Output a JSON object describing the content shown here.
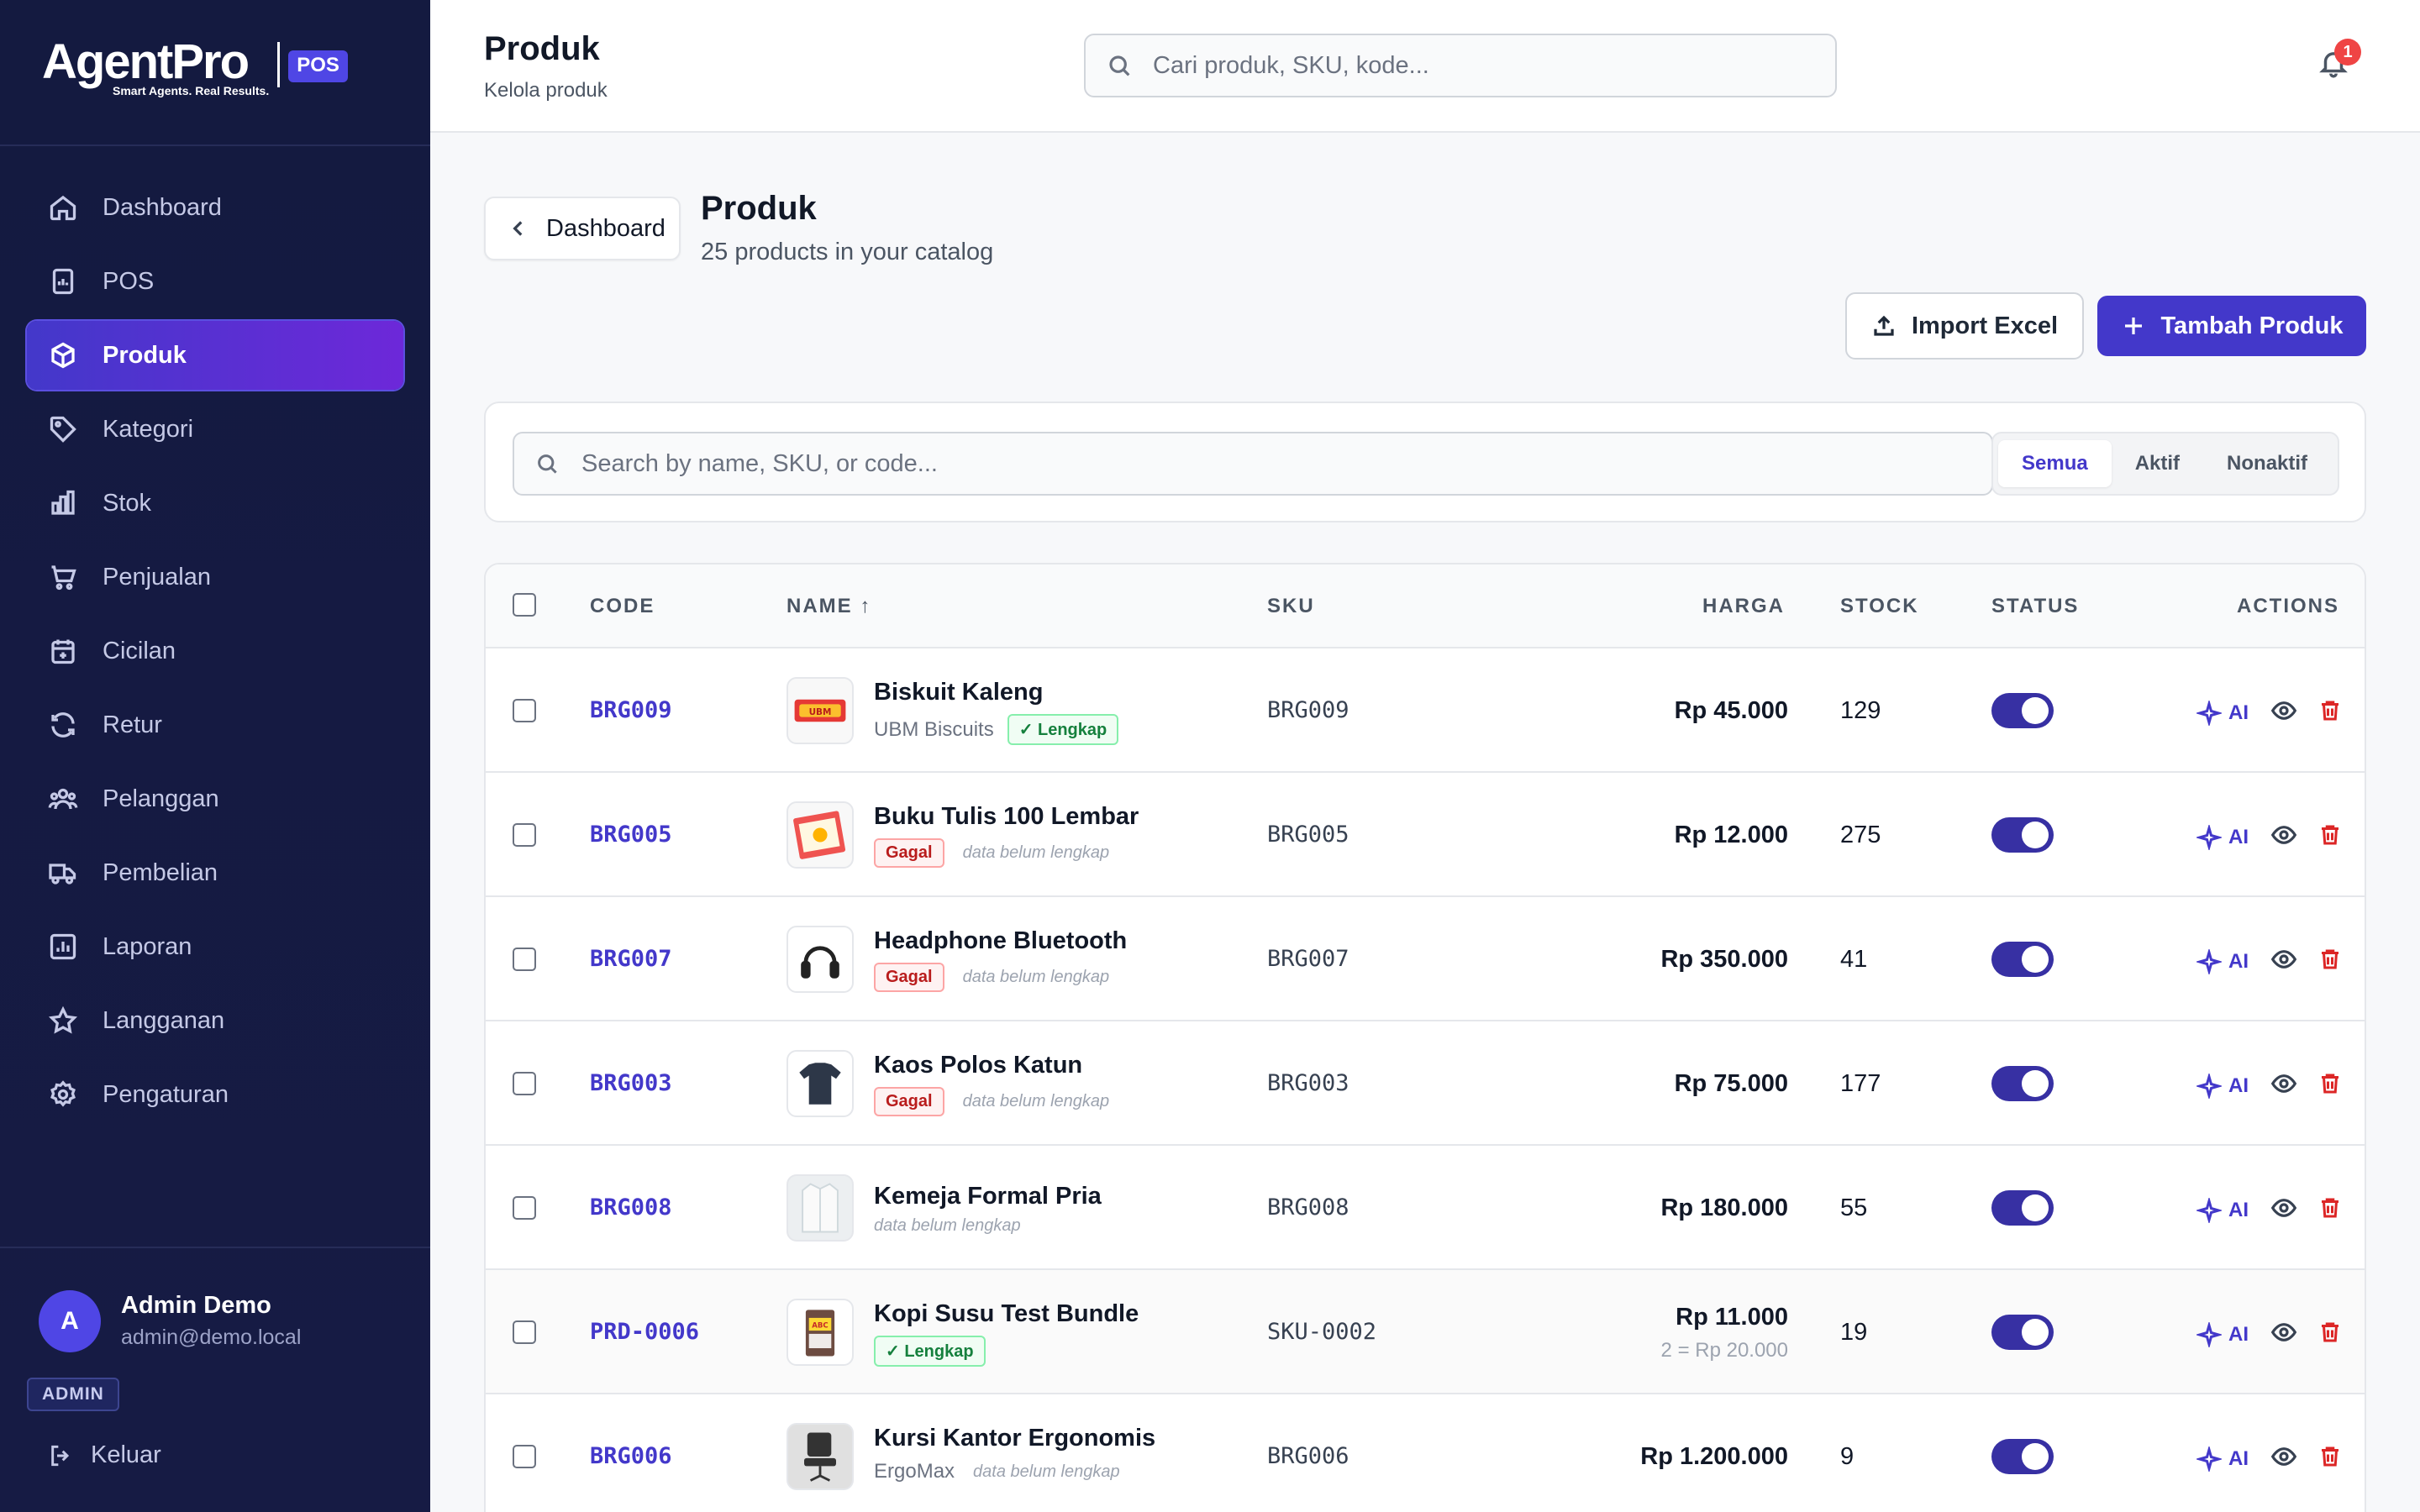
{
  "brand": {
    "name": "AgentPro",
    "tagline": "Smart Agents. Real Results.",
    "badge": "POS"
  },
  "sidebar": {
    "items": [
      {
        "label": "Dashboard",
        "icon": "home-icon"
      },
      {
        "label": "POS",
        "icon": "receipt-icon"
      },
      {
        "label": "Produk",
        "icon": "box-icon",
        "active": true
      },
      {
        "label": "Kategori",
        "icon": "tag-icon"
      },
      {
        "label": "Stok",
        "icon": "bar-chart-icon"
      },
      {
        "label": "Penjualan",
        "icon": "cart-icon"
      },
      {
        "label": "Cicilan",
        "icon": "calendar-icon"
      },
      {
        "label": "Retur",
        "icon": "refresh-icon"
      },
      {
        "label": "Pelanggan",
        "icon": "users-icon"
      },
      {
        "label": "Pembelian",
        "icon": "truck-icon"
      },
      {
        "label": "Laporan",
        "icon": "report-icon"
      },
      {
        "label": "Langganan",
        "icon": "star-icon"
      },
      {
        "label": "Pengaturan",
        "icon": "gear-icon"
      }
    ]
  },
  "user": {
    "initial": "A",
    "name": "Admin Demo",
    "email": "admin@demo.local",
    "role": "ADMIN",
    "logout": "Keluar"
  },
  "header": {
    "title": "Produk",
    "subtitle": "Kelola produk",
    "search_placeholder": "Cari produk, SKU, kode...",
    "notif_count": "1"
  },
  "page": {
    "back_label": "Dashboard",
    "title": "Produk",
    "subtitle": "25 products in your catalog",
    "import_label": "Import Excel",
    "add_label": "Tambah Produk"
  },
  "filter": {
    "search_placeholder": "Search by name, SKU, or code...",
    "tabs": [
      "Semua",
      "Aktif",
      "Nonaktif"
    ],
    "active_tab": "Semua"
  },
  "table": {
    "columns": {
      "code": "CODE",
      "name": "NAME ↑",
      "sku": "SKU",
      "price": "HARGA",
      "stock": "STOCK",
      "status": "STATUS",
      "actions": "ACTIONS"
    },
    "ai_label": "AI",
    "rows": [
      {
        "code": "BRG009",
        "name": "Biskuit Kaleng",
        "brand": "UBM Biscuits",
        "badge": "✓ Lengkap",
        "badge_type": "ok",
        "note": "",
        "sku": "BRG009",
        "price": "Rp 45.000",
        "price_sub": "",
        "stock": "129",
        "active": true
      },
      {
        "code": "BRG005",
        "name": "Buku Tulis 100 Lembar",
        "brand": "",
        "badge": "Gagal",
        "badge_type": "fail",
        "note": "data belum lengkap",
        "sku": "BRG005",
        "price": "Rp 12.000",
        "price_sub": "",
        "stock": "275",
        "active": true
      },
      {
        "code": "BRG007",
        "name": "Headphone Bluetooth",
        "brand": "",
        "badge": "Gagal",
        "badge_type": "fail",
        "note": "data belum lengkap",
        "sku": "BRG007",
        "price": "Rp 350.000",
        "price_sub": "",
        "stock": "41",
        "active": true
      },
      {
        "code": "BRG003",
        "name": "Kaos Polos Katun",
        "brand": "",
        "badge": "Gagal",
        "badge_type": "fail",
        "note": "data belum lengkap",
        "sku": "BRG003",
        "price": "Rp 75.000",
        "price_sub": "",
        "stock": "177",
        "active": true
      },
      {
        "code": "BRG008",
        "name": "Kemeja Formal Pria",
        "brand": "",
        "badge": "",
        "badge_type": "",
        "note": "data belum lengkap",
        "sku": "BRG008",
        "price": "Rp 180.000",
        "price_sub": "",
        "stock": "55",
        "active": true
      },
      {
        "code": "PRD-0006",
        "name": "Kopi Susu Test Bundle",
        "brand": "",
        "badge": "✓ Lengkap",
        "badge_type": "ok",
        "note": "",
        "sku": "SKU-0002",
        "price": "Rp 11.000",
        "price_sub": "2 = Rp 20.000",
        "stock": "19",
        "active": true
      },
      {
        "code": "BRG006",
        "name": "Kursi Kantor Ergonomis",
        "brand": "ErgoMax",
        "badge": "",
        "badge_type": "",
        "note": "data belum lengkap",
        "sku": "BRG006",
        "price": "Rp 1.200.000",
        "price_sub": "",
        "stock": "9",
        "active": true
      }
    ]
  },
  "colors": {
    "accent": "#4338ca",
    "sidebar_bg": "#141a40",
    "danger": "#dc2626",
    "success": "#15803d"
  }
}
